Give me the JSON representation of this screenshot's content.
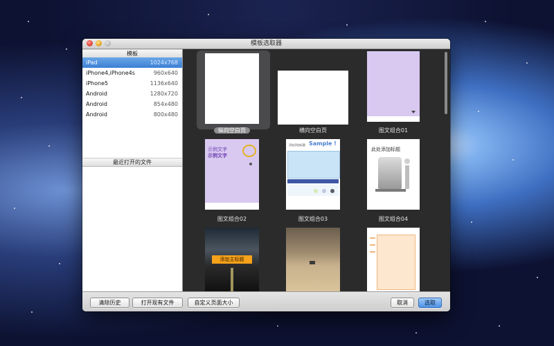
{
  "window": {
    "title": "模板选取器"
  },
  "left_panel": {
    "templates_header": "模板",
    "devices": [
      {
        "name": "iPad",
        "resolution": "1024x768",
        "selected": true
      },
      {
        "name": "iPhone4,iPhone4s",
        "resolution": "960x640",
        "selected": false
      },
      {
        "name": "iPhone5",
        "resolution": "1136x640",
        "selected": false
      },
      {
        "name": "Android",
        "resolution": "1280x720",
        "selected": false
      },
      {
        "name": "Android",
        "resolution": "854x480",
        "selected": false
      },
      {
        "name": "Android",
        "resolution": "800x480",
        "selected": false
      }
    ],
    "recent_header": "最近打开的文件"
  },
  "gallery": {
    "items": [
      {
        "caption": "纵向空白页",
        "selected": true
      },
      {
        "caption": "横向空白页",
        "selected": false
      },
      {
        "caption": "图文组合01",
        "selected": false
      },
      {
        "caption": "图文组合02",
        "selected": false
      },
      {
        "caption": "图文组合03",
        "selected": false
      },
      {
        "caption": "图文组合04",
        "selected": false
      }
    ],
    "thumb_text": {
      "t02_line1": "示例文字",
      "t02_line2": "示例文字",
      "t03_sample": "Sample !",
      "t03_tag": "添加添加标题",
      "t04_title": "此处添加标题",
      "t05_title": "添加主标题"
    }
  },
  "buttons": {
    "clear_history": "清除历史",
    "open_existing": "打开现有文件",
    "custom_page_size": "自定义页面大小",
    "cancel": "取消",
    "select": "选取"
  },
  "colors": {
    "selection_blue": "#3b7fd4",
    "gallery_bg": "#2b2b2c",
    "lavender": "#d9c9f1"
  }
}
